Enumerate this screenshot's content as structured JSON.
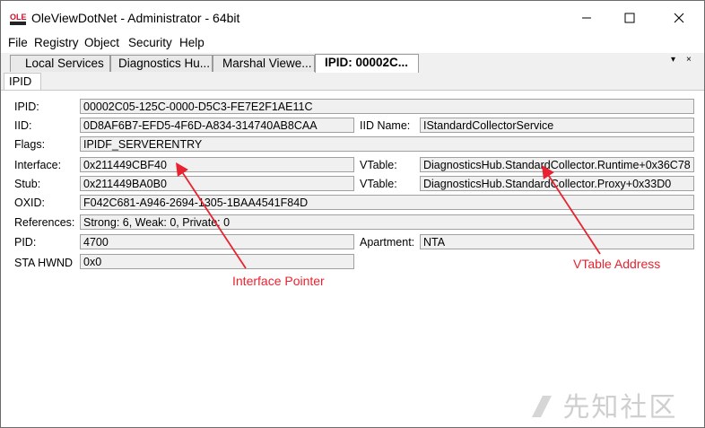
{
  "window": {
    "title": "OleViewDotNet - Administrator - 64bit",
    "icon_text": "OLE"
  },
  "menu": [
    "File",
    "Registry",
    "Object",
    "Security",
    "Help"
  ],
  "tabs": [
    {
      "label": "Local Services"
    },
    {
      "label": "Diagnostics Hu..."
    },
    {
      "label": "Marshal Viewe..."
    },
    {
      "label": "IPID: 00002C..."
    }
  ],
  "tab_controls": {
    "dropdown": "▾",
    "close": "×"
  },
  "subtab": {
    "label": "IPID"
  },
  "fields": {
    "ipid": {
      "label": "IPID:",
      "value": "00002C05-125C-0000-D5C3-FE7E2F1AE11C"
    },
    "iid": {
      "label": "IID:",
      "value": "0D8AF6B7-EFD5-4F6D-A834-314740AB8CAA"
    },
    "iid_name": {
      "label": "IID Name:",
      "value": "IStandardCollectorService"
    },
    "flags": {
      "label": "Flags:",
      "value": "IPIDF_SERVERENTRY"
    },
    "interface": {
      "label": "Interface:",
      "value": "0x211449CBF40"
    },
    "vtable1": {
      "label": "VTable:",
      "value": "DiagnosticsHub.StandardCollector.Runtime+0x36C78"
    },
    "stub": {
      "label": "Stub:",
      "value": "0x211449BA0B0"
    },
    "vtable2": {
      "label": "VTable:",
      "value": "DiagnosticsHub.StandardCollector.Proxy+0x33D0"
    },
    "oxid": {
      "label": "OXID:",
      "value": "F042C681-A946-2694-1305-1BAA4541F84D"
    },
    "references": {
      "label": "References:",
      "value": "Strong: 6, Weak: 0, Private: 0"
    },
    "pid": {
      "label": "PID:",
      "value": "4700"
    },
    "apartment": {
      "label": "Apartment:",
      "value": "NTA"
    },
    "sta_hwnd": {
      "label": "STA HWND",
      "value": "0x0"
    }
  },
  "annotations": {
    "interface_pointer": "Interface Pointer",
    "vtable_address": "VTable Address",
    "color": "#e8232f"
  },
  "watermark": "先知社区"
}
